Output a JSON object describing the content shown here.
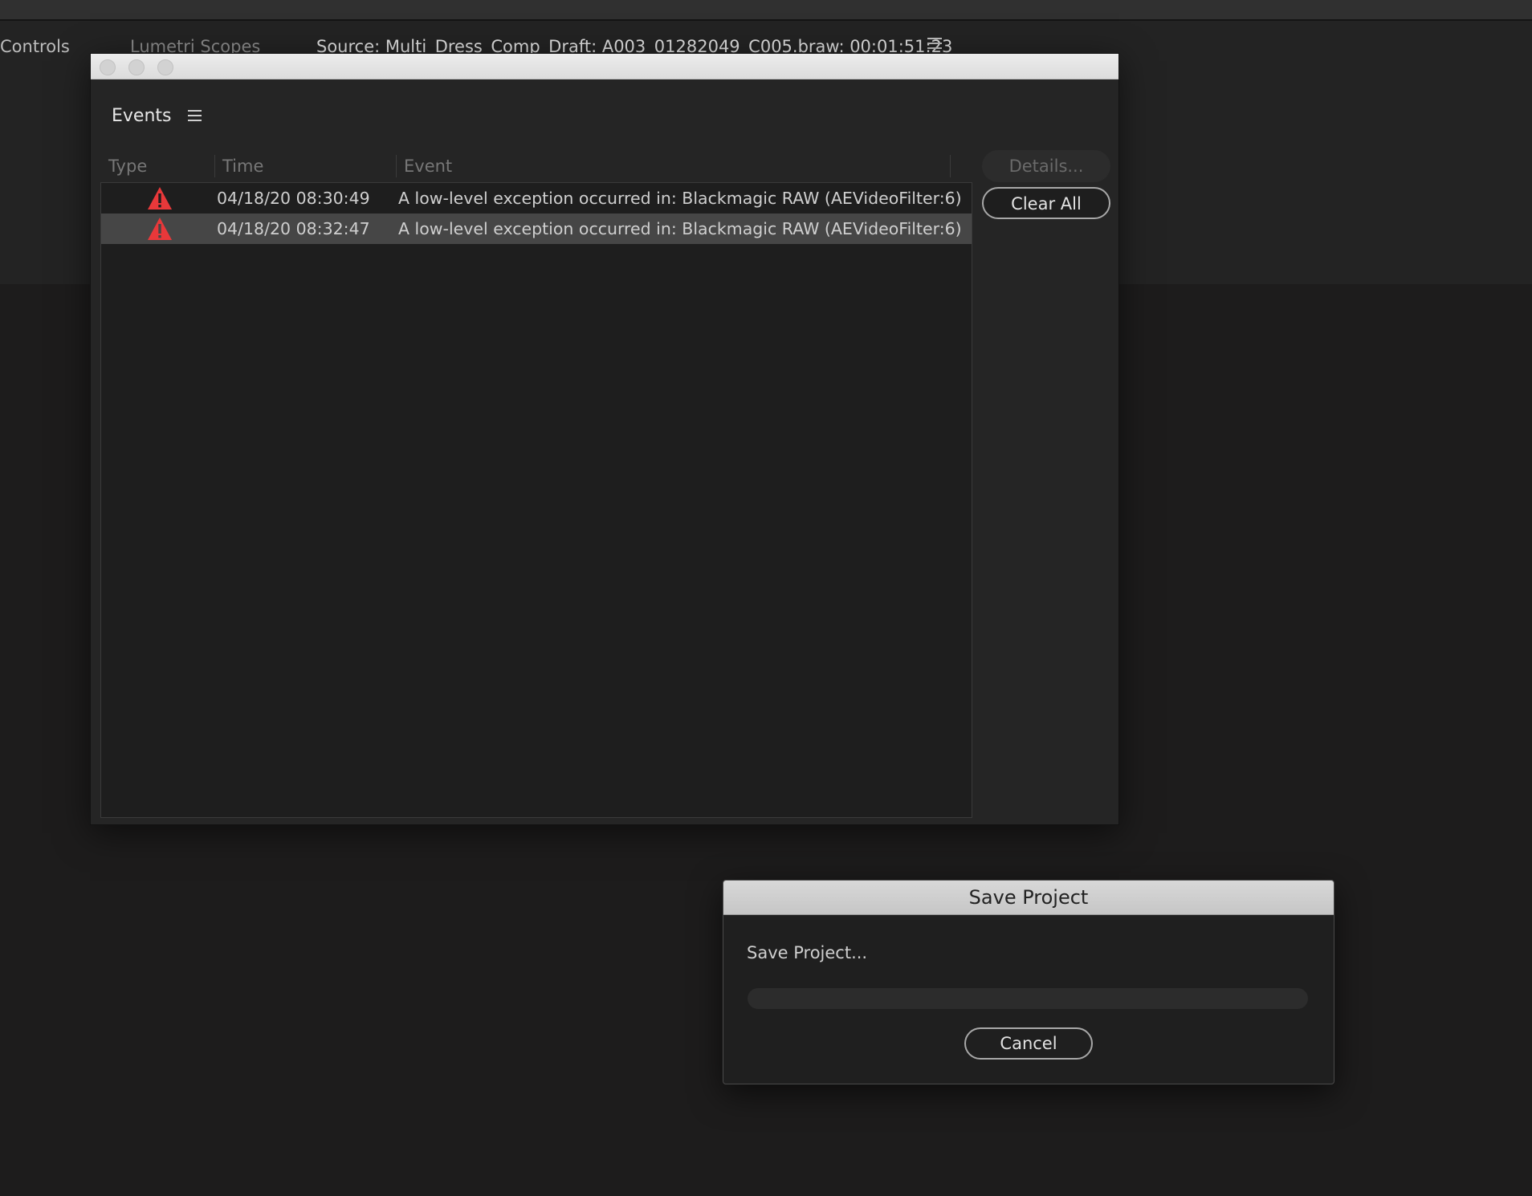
{
  "background": {
    "tabs": {
      "controls": "Controls",
      "lumetri": "Lumetri Scopes",
      "source": "Source: Multi_Dress_Comp_Draft: A003_01282049_C005.braw: 00:01:51:23"
    }
  },
  "events_window": {
    "title": "Events",
    "columns": {
      "type": "Type",
      "time": "Time",
      "event": "Event"
    },
    "rows": [
      {
        "type_icon": "warning-icon",
        "time": "04/18/20 08:30:49",
        "event": "A low-level exception occurred in: Blackmagic RAW (AEVideoFilter:6)"
      },
      {
        "type_icon": "warning-icon",
        "time": "04/18/20 08:32:47",
        "event": "A low-level exception occurred in: Blackmagic RAW (AEVideoFilter:6)"
      }
    ],
    "buttons": {
      "details": "Details...",
      "clear_all": "Clear All"
    },
    "colors": {
      "warning": "#e8383a",
      "selected_row": "#464646"
    }
  },
  "save_dialog": {
    "title": "Save Project",
    "message": "Save Project...",
    "progress": 0,
    "cancel_label": "Cancel"
  }
}
